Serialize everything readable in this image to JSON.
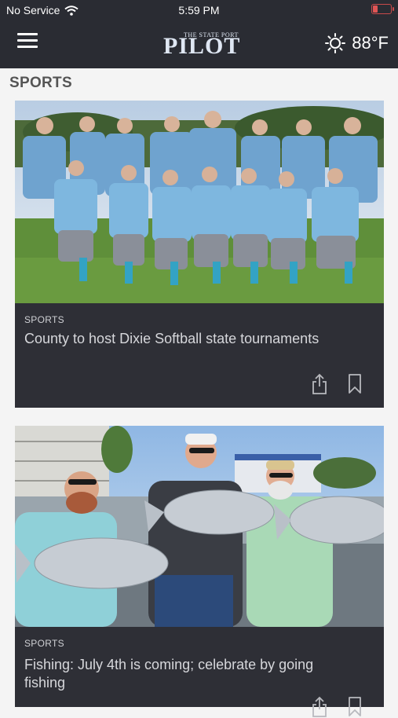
{
  "status_bar": {
    "carrier": "No Service",
    "time": "5:59 PM",
    "battery_level": 0.3
  },
  "header": {
    "logo_small": "THE STATE PORT",
    "logo_big": "PILOT",
    "temperature": "88°F",
    "weather_icon": "sun-icon"
  },
  "section": {
    "title": "SPORTS"
  },
  "articles": [
    {
      "category": "SPORTS",
      "headline": "County to host Dixie Softball state tournaments",
      "image": "team-photo"
    },
    {
      "category": "SPORTS",
      "headline": "Fishing: July 4th is coming; celebrate by going fishing",
      "image": "fishing-photo"
    }
  ],
  "colors": {
    "bar": "#2a2c33",
    "card": "#2e2f36",
    "accent": "#dfe7f3"
  }
}
